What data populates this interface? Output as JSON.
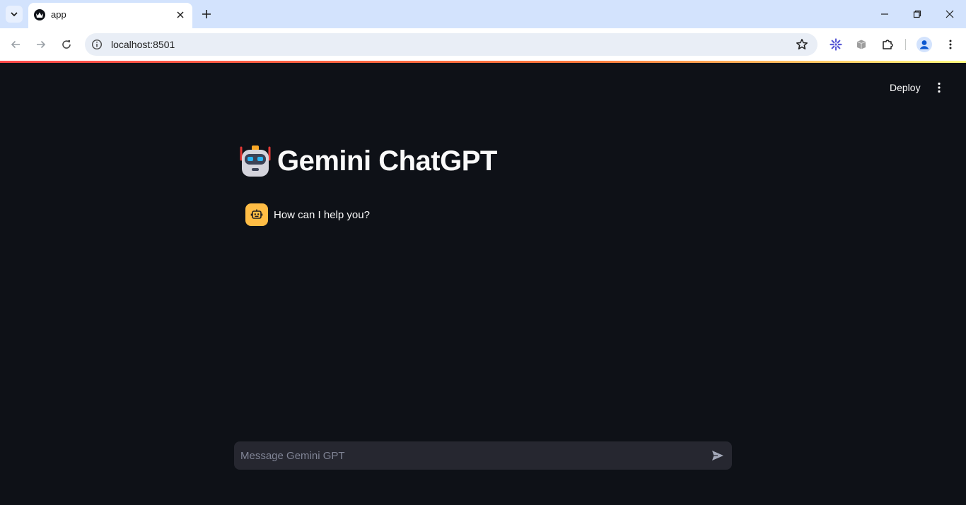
{
  "browser": {
    "tab": {
      "title": "app"
    },
    "address": {
      "url": "localhost:8501"
    }
  },
  "app": {
    "header": {
      "deploy_label": "Deploy"
    },
    "title": "Gemini ChatGPT",
    "messages": [
      {
        "role": "assistant",
        "text": "How can I help you?"
      }
    ],
    "chat_input": {
      "placeholder": "Message Gemini GPT"
    }
  },
  "colors": {
    "background": "#0e1117",
    "avatar": "#ffbd45",
    "input_bg": "#262730",
    "accent": "#ff4b4b"
  }
}
